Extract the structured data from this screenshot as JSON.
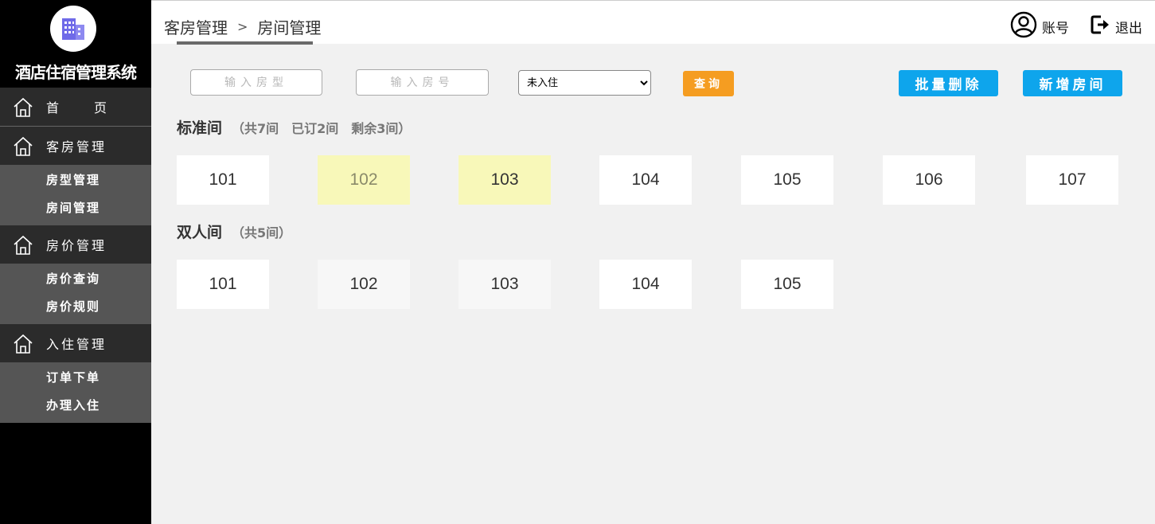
{
  "sidebar": {
    "brand_title": "酒店住宿管理系统",
    "home": {
      "first": "首",
      "second": "页"
    },
    "menus": [
      {
        "label": "客房管理",
        "items": [
          "房型管理",
          "房间管理"
        ]
      },
      {
        "label": "房价管理",
        "items": [
          "房价查询",
          "房价规则"
        ]
      },
      {
        "label": "入住管理",
        "items": [
          "订单下单",
          "办理入住"
        ]
      }
    ]
  },
  "header": {
    "breadcrumb": [
      "客房管理",
      "房间管理"
    ],
    "breadcrumb_sep": ">",
    "account_label": "账号",
    "logout_label": "退出"
  },
  "toolbar": {
    "room_type_placeholder": "输入房型",
    "room_no_placeholder": "输入房号",
    "status_selected": "未入住",
    "query_label": "查询",
    "batch_delete_label": "批量删除",
    "add_room_label": "新增房间"
  },
  "sections": [
    {
      "name": "标准间",
      "stats": "（共7间　已订2间　剩余3间）",
      "rooms": [
        {
          "no": "101",
          "state": "free"
        },
        {
          "no": "102",
          "state": "booked"
        },
        {
          "no": "103",
          "state": "booked"
        },
        {
          "no": "104",
          "state": "free"
        },
        {
          "no": "105",
          "state": "free"
        },
        {
          "no": "106",
          "state": "free"
        },
        {
          "no": "107",
          "state": "free"
        }
      ]
    },
    {
      "name": "双人间",
      "stats": "（共5间）",
      "rooms": [
        {
          "no": "101",
          "state": "free"
        },
        {
          "no": "102",
          "state": "muted"
        },
        {
          "no": "103",
          "state": "muted"
        },
        {
          "no": "104",
          "state": "free"
        },
        {
          "no": "105",
          "state": "free"
        }
      ]
    }
  ],
  "colors": {
    "sidebar_bg": "#000000",
    "menu_bg": "#2b2b2b",
    "submenu_bg": "#555555",
    "query_btn": "#f59d21",
    "action_btn": "#0ea5ec",
    "booked_room": "#f8f8b9",
    "muted_room": "#f7f7f7"
  }
}
